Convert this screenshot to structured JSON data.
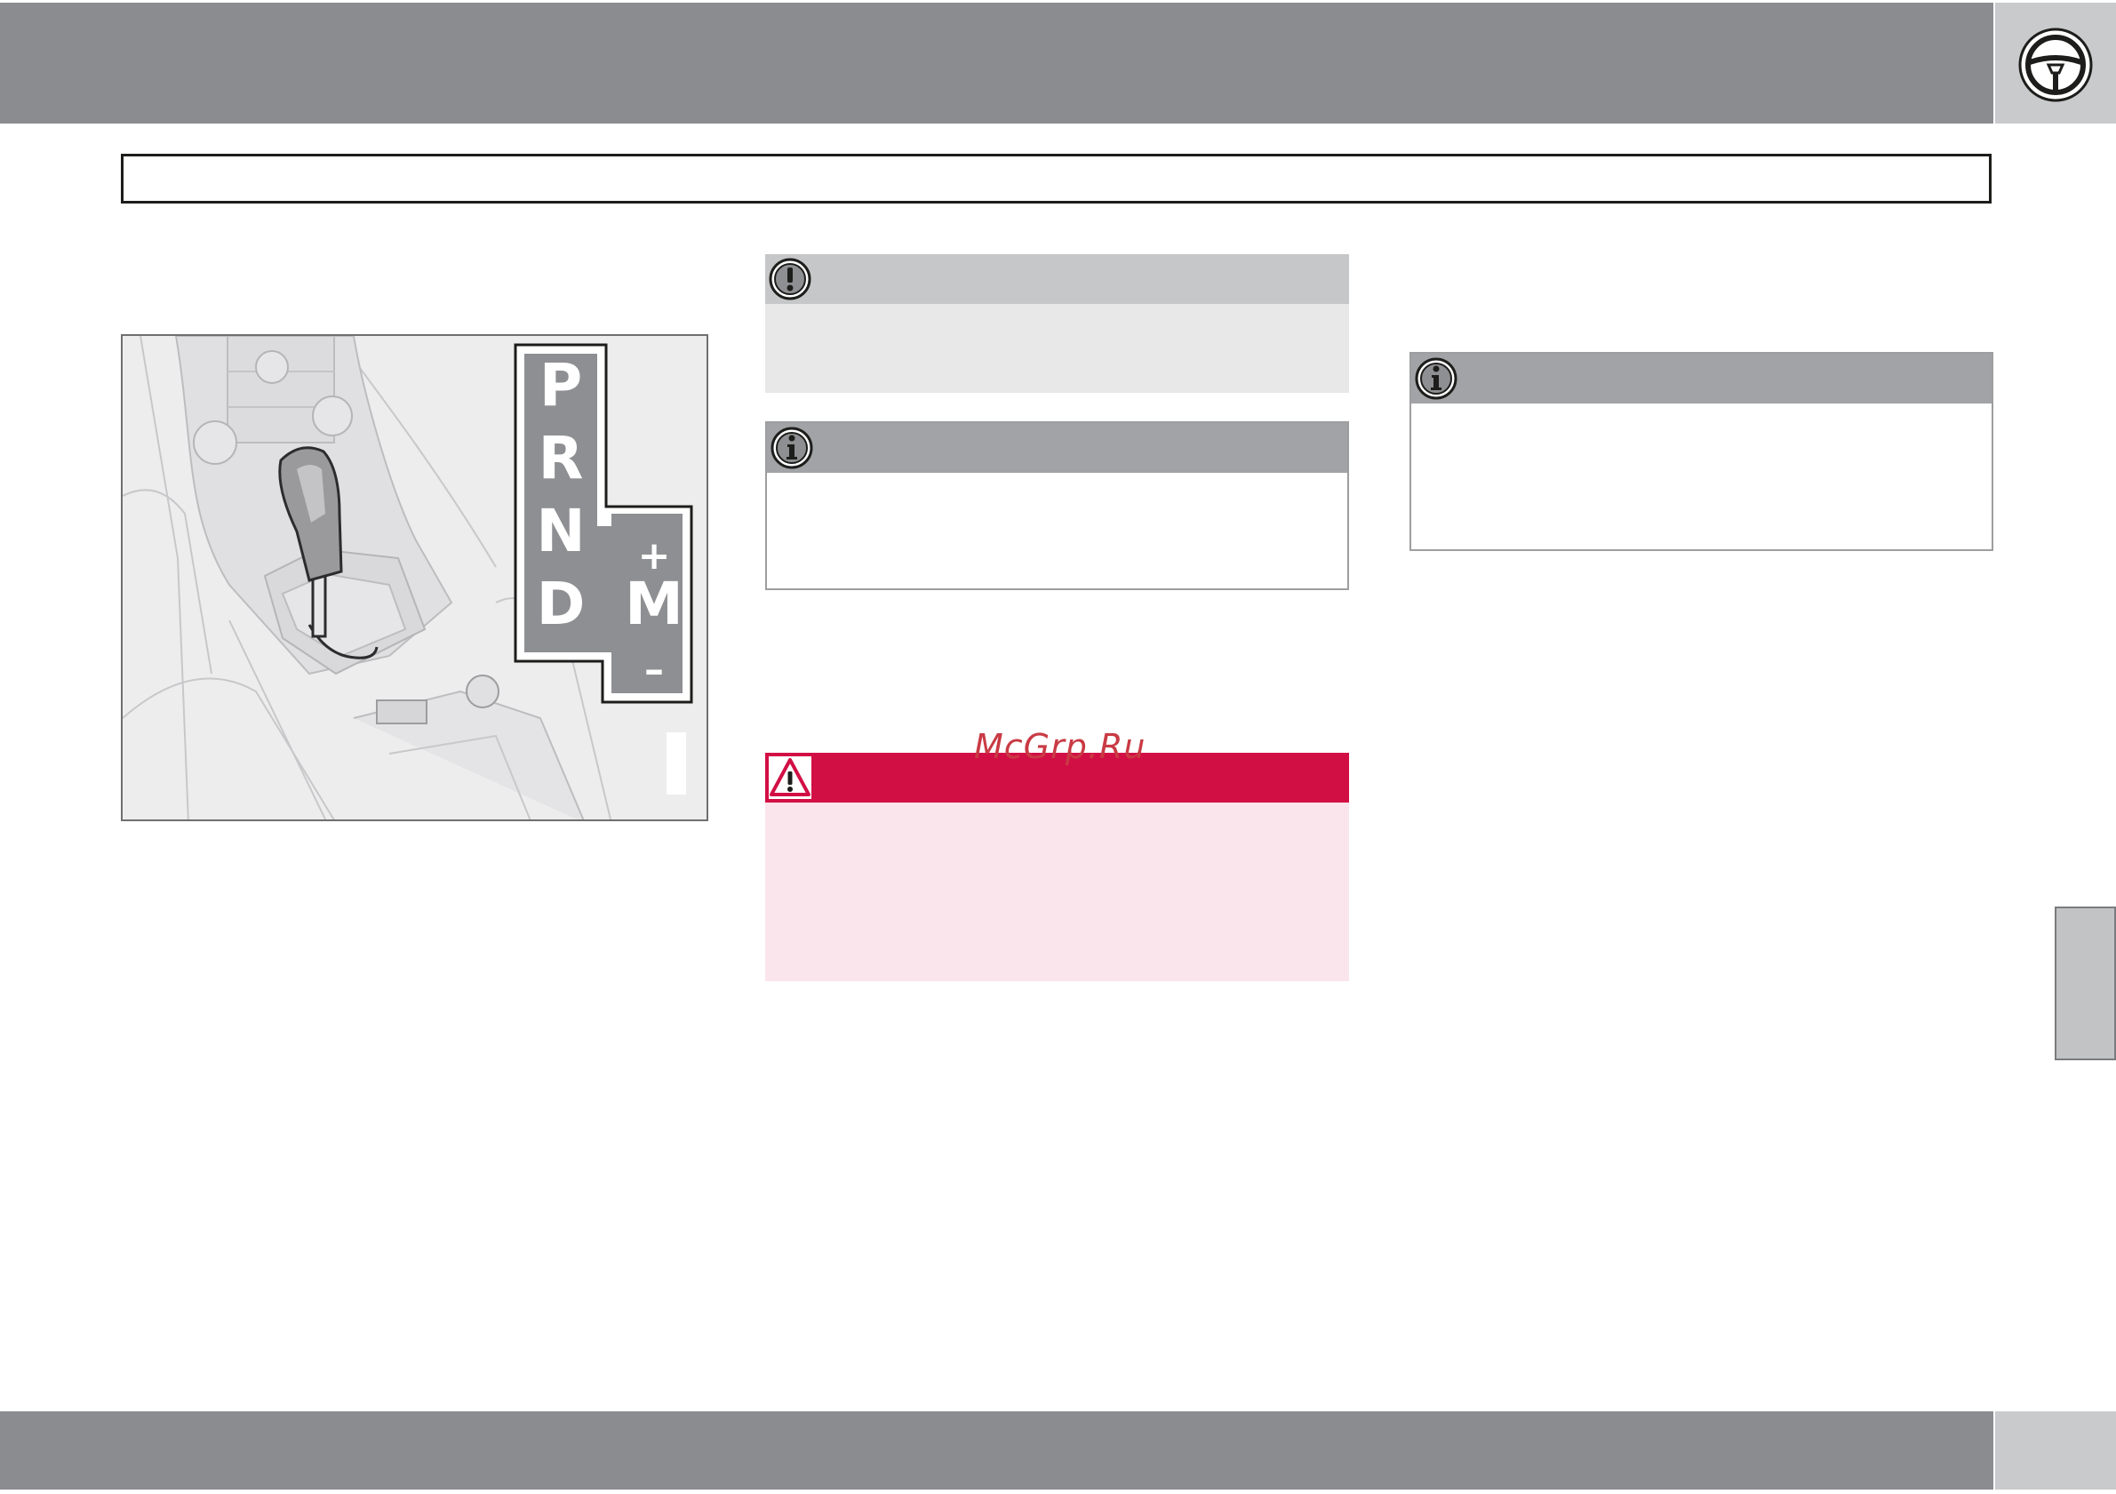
{
  "header": {
    "icon": "steering-wheel-icon",
    "section_title": ""
  },
  "figure": {
    "gear_positions": [
      "P",
      "R",
      "N",
      "D"
    ],
    "manual_gate": {
      "label": "M",
      "up": "+",
      "down": "–"
    }
  },
  "notes": {
    "caution": {
      "icon": "exclamation-icon"
    },
    "info_1": {
      "icon": "info-icon"
    },
    "warning": {
      "icon": "warning-triangle-icon"
    },
    "info_2": {
      "icon": "info-icon"
    }
  },
  "watermark": "McGrp.Ru",
  "colors": {
    "banner": "#8b8c90",
    "warning_red": "#d20f45",
    "warning_bg": "#fae5ec",
    "caution_bg": "#e8e8e9"
  }
}
